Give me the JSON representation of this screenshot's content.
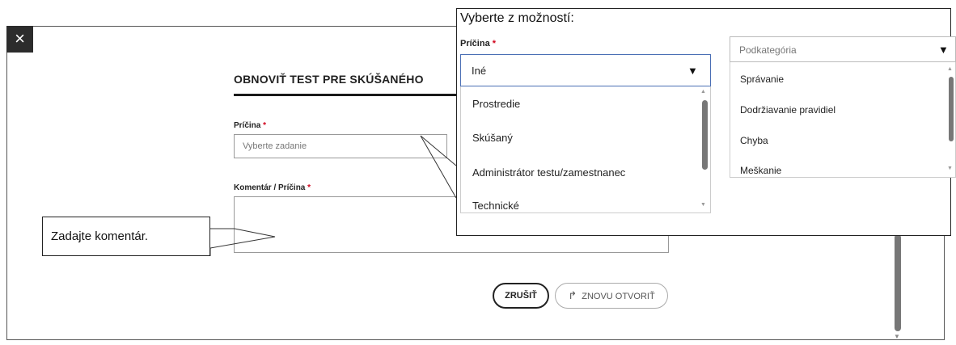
{
  "dialog": {
    "close_icon": "×",
    "title": "OBNOVIŤ TEST PRE SKÚŠANÉHO",
    "reason_label": "Príčina",
    "required_mark": "*",
    "reason_placeholder": "Vyberte zadanie",
    "comment_label": "Komentár / Príčina",
    "cancel_label": "ZRUŠIŤ",
    "reopen_icon": "↱",
    "reopen_label": "ZNOVU OTVORIŤ"
  },
  "callouts": {
    "comment": "Zadajte komentár."
  },
  "overlay": {
    "title": "Vyberte z možností:",
    "reason_label": "Príčina",
    "required_mark": "*",
    "selected_value": "Iné",
    "caret": "▼",
    "options": [
      "Prostredie",
      "Skúšaný",
      "Administrátor testu/zamestnanec",
      "Technické"
    ],
    "subcategory_placeholder": "Podkategória",
    "subcategory_options": [
      "Správanie",
      "Dodržiavanie pravidiel",
      "Chyba",
      "Meškanie"
    ]
  },
  "colors": {
    "accent_blue": "#2e6bb8",
    "required_red": "#d0021b",
    "close_bg": "#2c2c2c"
  }
}
